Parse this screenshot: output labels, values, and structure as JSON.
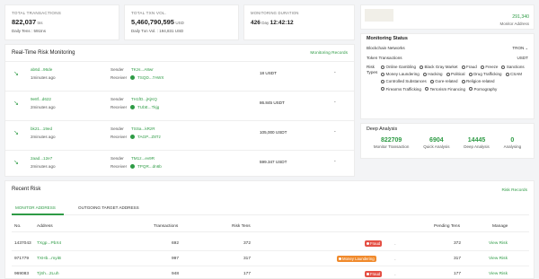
{
  "stats": {
    "total_transactions_label": "TOTAL TRANSACTIONS",
    "total_transactions_value": "822,037",
    "total_transactions_unit": "tns",
    "daily_tns_label": "Daily Tens :",
    "daily_tns_value": "591tns",
    "total_txn_vol_label": "TOTAL TXN VOL.",
    "total_txn_vol_value": "5,460,790,595",
    "total_txn_vol_unit": "USD",
    "daily_txn_vol_label": "Daily Txn Vol. :",
    "daily_txn_vol_value": "194,831 USD",
    "monitoring_duration_label": "MONITORING DURATION",
    "monitoring_days": "426",
    "monitoring_day_unit": "Day",
    "monitoring_time": "12:42:12"
  },
  "monitor_address": {
    "value": "291,340",
    "label": "Monitor Address"
  },
  "realtime": {
    "title": "Real-Time Risk Monitoring",
    "link": "Monitoring Records",
    "sender_label": "Sender",
    "receiver_label": "Receiver",
    "rows": [
      {
        "hash": "ab6d...96de",
        "time": "1minutes ago",
        "sender": "TKzs...A8wr",
        "receiver": "TSQD...7AWX",
        "amount": "18 USDT",
        "status": "-"
      },
      {
        "hash": "9e8f...d622",
        "time": "2minutes ago",
        "sender": "TH1fD...jKjKQ",
        "receiver": "TUbE...Tkjg",
        "amount": "86.845 USDT",
        "status": "-"
      },
      {
        "hash": "bk21...19ed",
        "time": "2minutes ago",
        "sender": "TSSa...kRzR",
        "receiver": "TAGP...Z8Tz",
        "amount": "105,000 USDT",
        "status": "-"
      },
      {
        "hash": "2aad...12e7",
        "time": "2minutes ago",
        "sender": "TM1z...ev9R",
        "receiver": "TPQR...dn6b",
        "amount": "599.347 USDT",
        "status": "-"
      }
    ]
  },
  "monitoring_status": {
    "title": "Monitoring Status",
    "network_label": "Blockchain Networks",
    "network_value": "TRON",
    "token_label": "Token Transactions",
    "token_value": "USDT",
    "risk_types_label": "Risk Types",
    "risk_types": [
      "Online Gambling",
      "Black Gray Market",
      "Fraud",
      "Freeze",
      "Sanctions",
      "Money Laundering",
      "Hacking",
      "Political",
      "Drug Trafficking",
      "CSAM",
      "Controlled Substances",
      "Gore-related",
      "Religion-related",
      "Firearms Trafficking",
      "Terrorism Financing",
      "Pornography"
    ]
  },
  "deep_analysis": {
    "title": "Deep Analysis",
    "items": [
      {
        "value": "822709",
        "label": "Monitor Transaction"
      },
      {
        "value": "6904",
        "label": "Quick Analysis"
      },
      {
        "value": "14445",
        "label": "Deep Analysis"
      },
      {
        "value": "0",
        "label": "Analysing"
      }
    ]
  },
  "recent_risk": {
    "title": "Recent Risk",
    "link": "Risk Records",
    "tabs": [
      "MONITOR ADDRESS",
      "OUTGOING TARGET ADDRESS"
    ],
    "columns": [
      "No.",
      "Address",
      "Transactions",
      "Risk Tens",
      "Pending Tens",
      "Manage"
    ],
    "rows": [
      {
        "no": "1437043",
        "address": "TXgp...PbX4",
        "transactions": "692",
        "risk_tens": "372",
        "tag": "Fraud",
        "tag_color": "#e45045",
        "pending": "372",
        "manage": "View Risk"
      },
      {
        "no": "971779",
        "address": "TXHb...myiB",
        "transactions": "997",
        "risk_tens": "317",
        "tag": "Money Laundering",
        "tag_color": "#f08a2c",
        "pending": "317",
        "manage": "View Risk"
      },
      {
        "no": "969083",
        "address": "TjSh...2Luh",
        "transactions": "948",
        "risk_tens": "177",
        "tag": "Fraud",
        "tag_color": "#e45045",
        "pending": "177",
        "manage": "View Risk"
      }
    ]
  },
  "colors": {
    "accent": "#2e9b45",
    "fraud": "#e45045",
    "laundering": "#f08a2c"
  }
}
